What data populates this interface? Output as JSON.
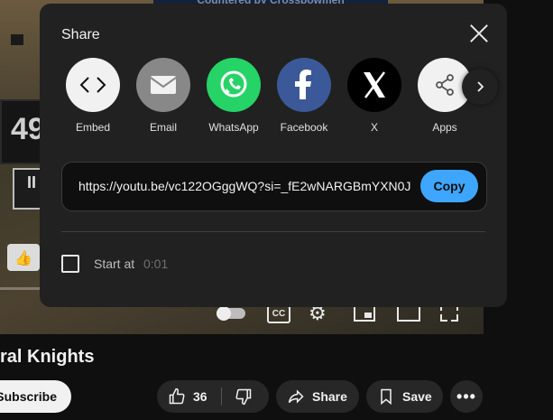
{
  "background": {
    "video_banner": "Countered by Crossbowmen",
    "hud_number": "49",
    "video_title": "ral Knights",
    "subscribe_label": "Subscribe",
    "like_count": "36",
    "share_label": "Share",
    "save_label": "Save"
  },
  "dialog": {
    "title": "Share",
    "targets": [
      {
        "label": "Embed",
        "icon": "embed-icon",
        "color": "#f1f1f1"
      },
      {
        "label": "Email",
        "icon": "email-icon",
        "color": "#888888"
      },
      {
        "label": "WhatsApp",
        "icon": "whatsapp-icon",
        "color": "#25d366"
      },
      {
        "label": "Facebook",
        "icon": "facebook-icon",
        "color": "#3b5998"
      },
      {
        "label": "X",
        "icon": "x-icon",
        "color": "#000000"
      },
      {
        "label": "Apps",
        "icon": "share-icon",
        "color": "#f1f1f1"
      }
    ],
    "url": "https://youtu.be/vc122OGggWQ?si=_fE2wNARGBmYXN0J",
    "copy_label": "Copy",
    "start_at_label": "Start at",
    "start_at_time": "0:01",
    "start_at_checked": false
  },
  "colors": {
    "accent": "#3ea6ff",
    "dialog_bg": "#212121",
    "page_bg": "#0f0f0f"
  }
}
